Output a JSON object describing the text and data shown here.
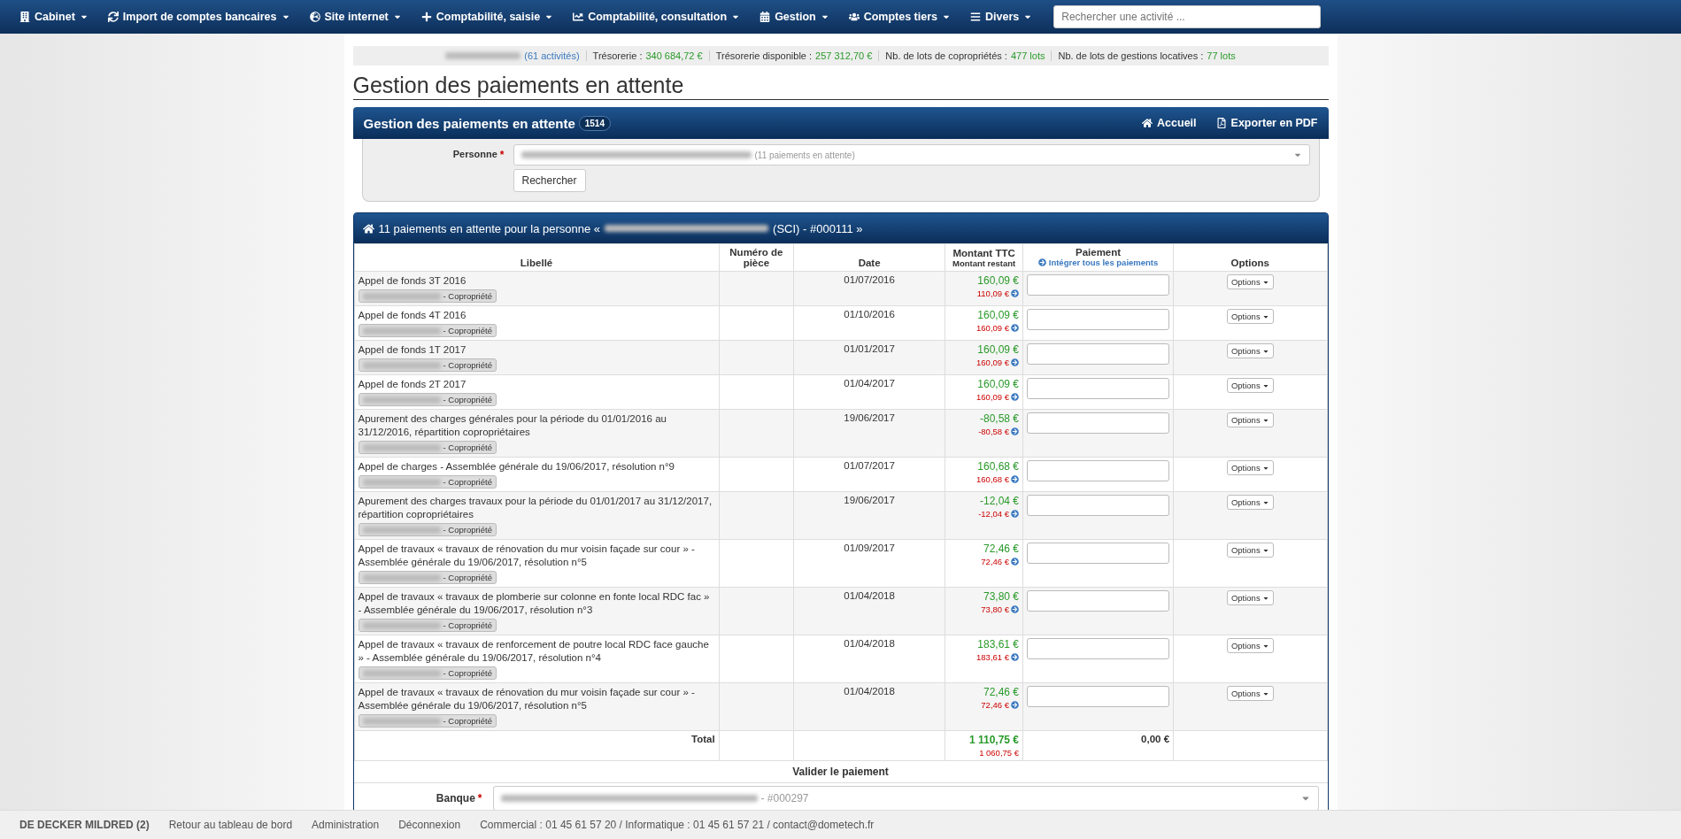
{
  "nav": {
    "items": [
      {
        "label": "Cabinet"
      },
      {
        "label": "Import de comptes bancaires"
      },
      {
        "label": "Site internet"
      },
      {
        "label": "Comptabilité, saisie"
      },
      {
        "label": "Comptabilité, consultation"
      },
      {
        "label": "Gestion"
      },
      {
        "label": "Comptes tiers"
      },
      {
        "label": "Divers"
      }
    ],
    "search_placeholder": "Rechercher une activité ..."
  },
  "info_bar": {
    "activities": "(61 activités)",
    "stats": [
      {
        "label": "Trésorerie :",
        "value": "340 684,72 €"
      },
      {
        "label": "Trésorerie disponible :",
        "value": "257 312,70 €"
      },
      {
        "label": "Nb. de lots de copropriétés :",
        "value": "477 lots"
      },
      {
        "label": "Nb. de lots de gestions locatives :",
        "value": "77 lots"
      }
    ]
  },
  "page_title": "Gestion des paiements en attente",
  "panel": {
    "title": "Gestion des paiements en attente",
    "badge": "1514",
    "actions": [
      {
        "label": "Accueil"
      },
      {
        "label": "Exporter en PDF"
      }
    ]
  },
  "search_form": {
    "label": "Personne",
    "required_mark": "*",
    "select_suffix": "(11 paiements en attente)",
    "button": "Rechercher"
  },
  "results": {
    "title_start": "11 paiements en attente pour la personne «",
    "title_end": "(SCI) - #000111 »",
    "columns": {
      "libelle": "Libellé",
      "numero": "Numéro de pièce",
      "date": "Date",
      "montant": "Montant TTC",
      "montant_sub": "Montant restant",
      "paiement": "Paiement",
      "paiement_link": "Intégrer tous les paiements",
      "options": "Options"
    },
    "rows": [
      {
        "libelle": "Appel de fonds 3T 2016",
        "tag": "- Copropriété",
        "date": "01/07/2016",
        "montant": "160,09 €",
        "restant": "110,09 €",
        "options": "Options"
      },
      {
        "libelle": "Appel de fonds 4T 2016",
        "tag": "- Copropriété",
        "date": "01/10/2016",
        "montant": "160,09 €",
        "restant": "160,09 €",
        "options": "Options"
      },
      {
        "libelle": "Appel de fonds 1T 2017",
        "tag": "- Copropriété",
        "date": "01/01/2017",
        "montant": "160,09 €",
        "restant": "160,09 €",
        "options": "Options"
      },
      {
        "libelle": "Appel de fonds 2T 2017",
        "tag": "- Copropriété",
        "date": "01/04/2017",
        "montant": "160,09 €",
        "restant": "160,09 €",
        "options": "Options"
      },
      {
        "libelle": "Apurement des charges générales pour la période du 01/01/2016 au 31/12/2016, répartition copropriétaires",
        "tag": "- Copropriété",
        "date": "19/06/2017",
        "montant": "-80,58 €",
        "restant": "-80,58 €",
        "options": "Options"
      },
      {
        "libelle": "Appel de charges - Assemblée générale du 19/06/2017, résolution n°9",
        "tag": "- Copropriété",
        "date": "01/07/2017",
        "montant": "160,68 €",
        "restant": "160,68 €",
        "options": "Options"
      },
      {
        "libelle": "Apurement des charges travaux pour la période du 01/01/2017 au 31/12/2017, répartition copropriétaires",
        "tag": "- Copropriété",
        "date": "19/06/2017",
        "montant": "-12,04 €",
        "restant": "-12,04 €",
        "options": "Options"
      },
      {
        "libelle": "Appel de travaux « travaux de rénovation du mur voisin façade sur cour » - Assemblée générale du 19/06/2017, résolution n°5",
        "tag": "- Copropriété",
        "date": "01/09/2017",
        "montant": "72,46 €",
        "restant": "72,46 €",
        "options": "Options"
      },
      {
        "libelle": "Appel de travaux « travaux de plomberie sur colonne en fonte local RDC fac » - Assemblée générale du 19/06/2017, résolution n°3",
        "tag": "- Copropriété",
        "date": "01/04/2018",
        "montant": "73,80 €",
        "restant": "73,80 €",
        "options": "Options"
      },
      {
        "libelle": "Appel de travaux « travaux de renforcement de poutre local RDC face gauche » - Assemblée générale du 19/06/2017, résolution n°4",
        "tag": "- Copropriété",
        "date": "01/04/2018",
        "montant": "183,61 €",
        "restant": "183,61 €",
        "options": "Options"
      },
      {
        "libelle": "Appel de travaux « travaux de rénovation du mur voisin façade sur cour » - Assemblée générale du 19/06/2017, résolution n°5",
        "tag": "- Copropriété",
        "date": "01/04/2018",
        "montant": "72,46 €",
        "restant": "72,46 €",
        "options": "Options"
      }
    ],
    "total": {
      "label": "Total",
      "montant": "1 110,75 €",
      "restant": "1 060,75 €",
      "paiement": "0,00 €"
    },
    "validate_title": "Valider le paiement",
    "bank": {
      "label": "Banque",
      "required_mark": "*",
      "select_suffix": "- #000297"
    }
  },
  "footer": {
    "user": "DE DECKER MILDRED (2)",
    "links": [
      "Retour au tableau de bord",
      "Administration",
      "Déconnexion"
    ],
    "contact": "Commercial : 01 45 61 57 20 / Informatique : 01 45 61 57 21 / contact@dometech.fr"
  }
}
